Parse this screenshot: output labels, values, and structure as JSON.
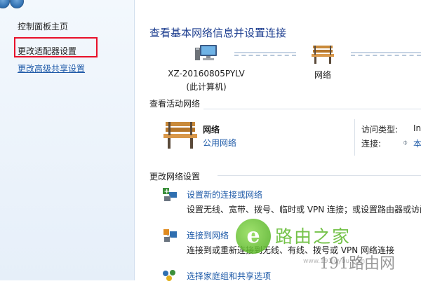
{
  "sidebar": {
    "home": "控制面板主页",
    "adapter": "更改适配器设置",
    "advanced": "更改高级共享设置"
  },
  "main": {
    "title": "查看基本网络信息并设置连接",
    "computer_name": "XZ-20160805PYLV",
    "computer_sub": "(此计算机)",
    "network_node": "网络",
    "active_header": "查看活动网络",
    "network_name": "网络",
    "network_type": "公用网络",
    "access_type_label": "访问类型:",
    "access_type_value": "In",
    "connection_label": "连接:",
    "connection_value": "本",
    "change_header": "更改网络设置",
    "tasks": [
      {
        "link": "设置新的连接或网络",
        "desc": "设置无线、宽带、拨号、临时或 VPN 连接；或设置路由器或访问"
      },
      {
        "link": "连接到网络",
        "desc": "连接到或重新连接到无线、有线、拨号或 VPN 网络连接"
      },
      {
        "link": "选择家庭组和共享选项",
        "desc": ""
      }
    ]
  },
  "watermark": {
    "logo_letter": "e",
    "brand": "路由之家",
    "url": "191路由网",
    "domain": "www.191luyou.com"
  },
  "colors": {
    "link": "#1e5aa8",
    "title": "#1e3f90",
    "highlight": "#e8102a",
    "watermark_green": "#5cb82a"
  }
}
